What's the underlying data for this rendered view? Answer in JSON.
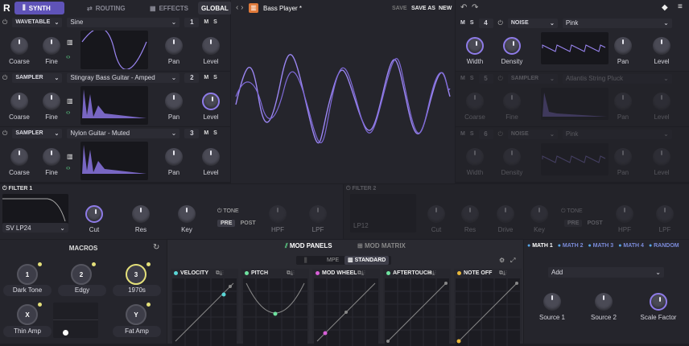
{
  "topbar": {
    "logo": "R",
    "tabs": [
      {
        "label": "SYNTH",
        "icon": "bars-icon"
      },
      {
        "label": "ROUTING",
        "icon": "routing-icon"
      },
      {
        "label": "EFFECTS",
        "icon": "fx-icon"
      }
    ],
    "global_label": "GLOBAL",
    "preset_name": "Bass Player *",
    "save": "SAVE",
    "save_as": "SAVE AS",
    "new": "NEW"
  },
  "layers": [
    {
      "type": "WAVETABLE",
      "source": "Sine",
      "num": "1",
      "m": "M",
      "s": "S",
      "knobs": [
        "Coarse",
        "Fine",
        "Pan",
        "Level"
      ]
    },
    {
      "type": "SAMPLER",
      "source": "Stingray Bass Guitar - Amped",
      "num": "2",
      "m": "M",
      "s": "S",
      "knobs": [
        "Coarse",
        "Fine",
        "Pan",
        "Level"
      ]
    },
    {
      "type": "SAMPLER",
      "source": "Nylon Guitar - Muted",
      "num": "3",
      "m": "M",
      "s": "S",
      "knobs": [
        "Coarse",
        "Fine",
        "Pan",
        "Level"
      ]
    }
  ],
  "right_layers": [
    {
      "num": "4",
      "m": "M",
      "s": "S",
      "type": "NOISE",
      "source": "Pink",
      "knobs": [
        "Width",
        "Density",
        "Pan",
        "Level"
      ]
    },
    {
      "num": "5",
      "m": "M",
      "s": "S",
      "type": "SAMPLER",
      "source": "Atlantis String Pluck",
      "knobs": [
        "Coarse",
        "Fine",
        "Pan",
        "Level"
      ]
    },
    {
      "num": "6",
      "m": "M",
      "s": "S",
      "type": "NOISE",
      "source": "Pink",
      "knobs": [
        "Width",
        "Density",
        "Pan",
        "Level"
      ]
    }
  ],
  "filter1": {
    "title": "FILTER 1",
    "type": "SV LP24",
    "knobs": [
      "Cut",
      "Res",
      "Key"
    ],
    "tone": "TONE",
    "pre": "PRE",
    "post": "POST",
    "hpf": "HPF",
    "lpf": "LPF"
  },
  "filter2": {
    "title": "FILTER 2",
    "type": "LP12",
    "knobs": [
      "Cut",
      "Res",
      "Drive",
      "Key"
    ],
    "tone": "TONE",
    "pre": "PRE",
    "post": "POST",
    "hpf": "HPF",
    "lpf": "LPF"
  },
  "macros": {
    "title": "MACROS",
    "items": [
      {
        "num": "1",
        "label": "Dark Tone"
      },
      {
        "num": "2",
        "label": "Edgy"
      },
      {
        "num": "3",
        "label": "1970s"
      },
      {
        "num": "X",
        "label": "Thin Amp"
      },
      {
        "num": "Y",
        "label": "Fat Amp"
      }
    ]
  },
  "mod": {
    "tab_panels": "MOD PANELS",
    "tab_matrix": "MOD MATRIX",
    "mpe": "MPE",
    "standard": "STANDARD",
    "cards": [
      {
        "label": "VELOCITY",
        "color": "#59d6d6"
      },
      {
        "label": "PITCH",
        "color": "#6fe3a0"
      },
      {
        "label": "MOD WHEEL",
        "color": "#d85fd8"
      },
      {
        "label": "AFTERTOUCH",
        "color": "#6fe3a0"
      },
      {
        "label": "NOTE OFF",
        "color": "#e8b83a"
      }
    ]
  },
  "math": {
    "tabs": [
      "MATH 1",
      "MATH 2",
      "MATH 3",
      "MATH 4",
      "RANDOM"
    ],
    "mode": "Add",
    "knobs": [
      "Source 1",
      "Source 2",
      "Scale Factor"
    ]
  },
  "colors": {
    "accent": "#8e7be8",
    "tab_on": "#5f53b8"
  }
}
